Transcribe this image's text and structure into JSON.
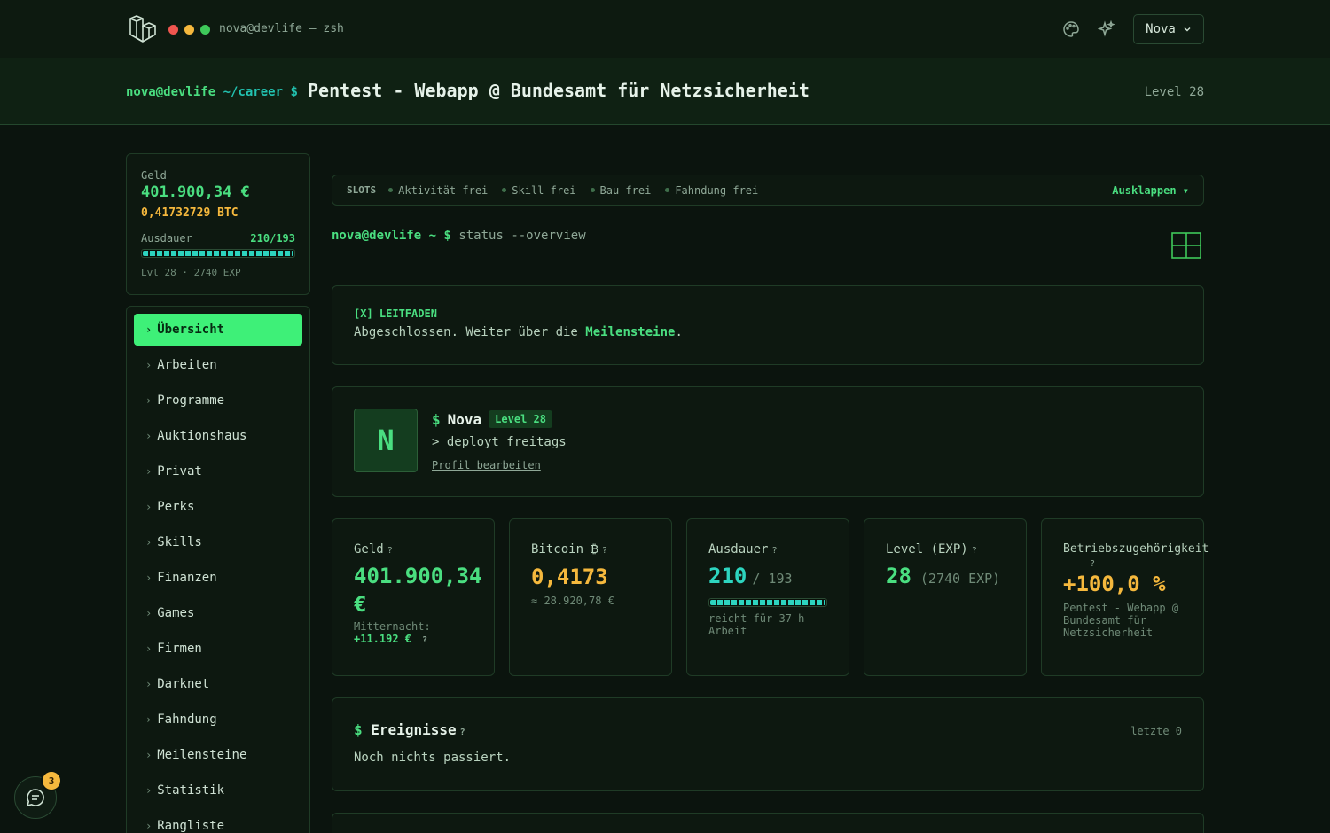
{
  "topbar": {
    "terminal_title": "nova@devlife — zsh",
    "user_label": "Nova",
    "dot_colors": [
      "#f0564f",
      "#f5b83d",
      "#3ec95a"
    ]
  },
  "header": {
    "prompt_user": "nova@devlife",
    "prompt_path": "~/career $",
    "title": "Pentest - Webapp @ Bundesamt für Netzsicherheit",
    "level": "Level 28"
  },
  "side_stats": {
    "geld_label": "Geld",
    "geld_value": "401.900,34 €",
    "btc_value": "0,41732729 BTC",
    "ausdauer_label": "Ausdauer",
    "ausdauer_value": "210/193",
    "ausdauer_fraction": 1.0,
    "level_line": "Lvl 28 · 2740 EXP"
  },
  "nav": {
    "items": [
      {
        "label": "Übersicht",
        "active": true
      },
      {
        "label": "Arbeiten"
      },
      {
        "label": "Programme"
      },
      {
        "label": "Auktionshaus"
      },
      {
        "label": "Privat"
      },
      {
        "label": "Perks"
      },
      {
        "label": "Skills"
      },
      {
        "label": "Finanzen"
      },
      {
        "label": "Games"
      },
      {
        "label": "Firmen"
      },
      {
        "label": "Darknet"
      },
      {
        "label": "Fahndung"
      },
      {
        "label": "Meilensteine"
      },
      {
        "label": "Statistik"
      },
      {
        "label": "Rangliste"
      }
    ]
  },
  "slots": {
    "title": "SLOTS",
    "items": [
      "Aktivität frei",
      "Skill frei",
      "Bau frei",
      "Fahndung frei"
    ],
    "expand_label": "Ausklappen ▾"
  },
  "command": {
    "user": "nova@devlife",
    "path": "~ $",
    "cmd": "status --overview"
  },
  "leitfaden": {
    "title": "[X] LEITFADEN",
    "text_before": "Abgeschlossen. Weiter über die ",
    "link": "Meilensteine",
    "text_after": "."
  },
  "profile": {
    "avatar_letter": "N",
    "prefix": "$",
    "name": "Nova",
    "badge": "Level 28",
    "motto": "> deployt freitags",
    "edit_label": "Profil bearbeiten"
  },
  "stats": {
    "geld": {
      "title": "Geld",
      "q": "?",
      "value": "401.900,34 €",
      "sub_label": "Mitternacht:",
      "sub_value": "+11.192 €",
      "sub_q": "?"
    },
    "bitcoin": {
      "title": "Bitcoin ₿",
      "q": "?",
      "value": "0,4173",
      "sub": "≈ 28.920,78 €"
    },
    "ausdauer": {
      "title": "Ausdauer",
      "q": "?",
      "value": "210",
      "max": "/ 193",
      "sub": "reicht für 37 h Arbeit",
      "fraction": 1.0
    },
    "level": {
      "title": "Level (EXP)",
      "q": "?",
      "value": "28",
      "exp": "(2740 EXP)"
    },
    "betrieb": {
      "title": "Betriebszugehörigkeit",
      "q": "?",
      "value": "+100,0 %",
      "sub": "Pentest - Webapp @ Bundesamt für Netzsicherheit"
    }
  },
  "events": {
    "prefix": "$",
    "title": "Ereignisse",
    "q": "?",
    "right": "letzte 0",
    "text": "Noch nichts passiert."
  },
  "chat": {
    "badge": "3"
  }
}
